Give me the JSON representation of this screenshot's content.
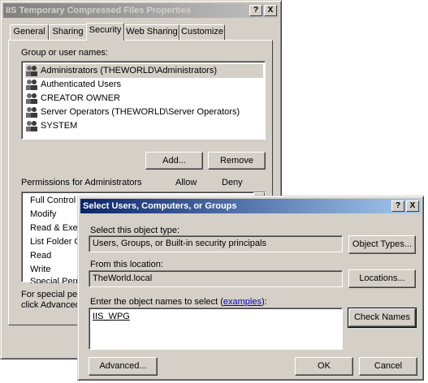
{
  "props": {
    "title": "IIS Temporary Compressed Files Properties",
    "help_glyph": "?",
    "close_glyph": "X",
    "tabs": [
      "General",
      "Sharing",
      "Security",
      "Web Sharing",
      "Customize"
    ],
    "group_label": "Group or user names:",
    "users": [
      "Administrators (THEWORLD\\Administrators)",
      "Authenticated Users",
      "CREATOR OWNER",
      "Server Operators (THEWORLD\\Server Operators)",
      "SYSTEM"
    ],
    "add_label": "Add...",
    "remove_label": "Remove",
    "permissions_label": "Permissions for Administrators",
    "allow_label": "Allow",
    "deny_label": "Deny",
    "permissions": [
      "Full Control",
      "Modify",
      "Read & Exec",
      "List Folder Co",
      "Read",
      "Write",
      "Special Perm"
    ],
    "special_line1": "For special perm",
    "special_line2": "click Advanced"
  },
  "dialog": {
    "title": "Select Users, Computers, or Groups",
    "help_glyph": "?",
    "close_glyph": "X",
    "object_type_label": "Select this object type:",
    "object_type_value": "Users, Groups, or Built-in security principals",
    "object_types_button": "Object Types...",
    "location_label": "From this location:",
    "location_value": "TheWorld.local",
    "locations_button": "Locations...",
    "names_label_prefix": "Enter the object names to select (",
    "names_label_link": "examples",
    "names_label_suffix": "):",
    "names_value": "IIS_WPG",
    "check_names_button": "Check Names",
    "advanced_button": "Advanced...",
    "ok_button": "OK",
    "cancel_button": "Cancel"
  },
  "colors": {
    "face": "#d4d0c8",
    "active_title": "#0a246a",
    "inactive_title": "#808080",
    "link": "#0000cc"
  }
}
